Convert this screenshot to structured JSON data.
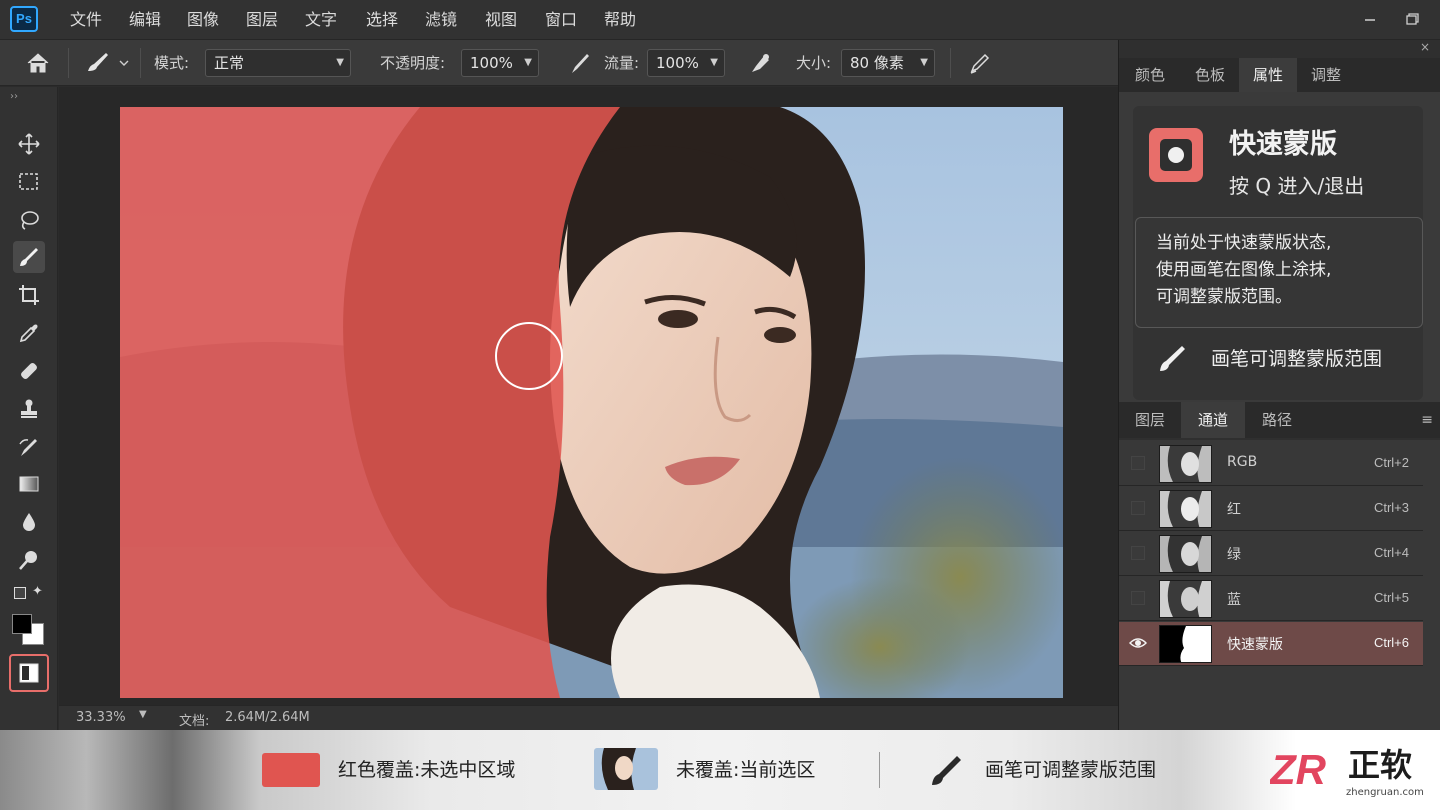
{
  "menubar": {
    "logo": "Ps",
    "items": [
      "文件",
      "编辑",
      "图像",
      "图层",
      "文字",
      "选择",
      "滤镜",
      "视图",
      "窗口",
      "帮助"
    ]
  },
  "options": {
    "mode_label": "模式:",
    "mode_value": "正常",
    "opacity_label": "不透明度:",
    "opacity_value": "100%",
    "flow_label": "流量:",
    "flow_value": "100%",
    "size_label": "大小:",
    "size_value": "80 像素"
  },
  "status": {
    "zoom": "33.33%",
    "doc_label": "文档:",
    "doc_value": "2.64M/2.64M"
  },
  "panel_top": {
    "tabs": [
      "颜色",
      "色板",
      "属性",
      "调整"
    ],
    "active_tab": "属性",
    "quickmask_title": "快速蒙版",
    "quickmask_subtitle": "按 Q 进入/退出",
    "desc_lines": [
      "当前处于快速蒙版状态,",
      "使用画笔在图像上涂抹,",
      "可调整蒙版范围。"
    ],
    "brush_hint": "画笔可调整蒙版范围"
  },
  "panel_bottom": {
    "tabs": [
      "图层",
      "通道",
      "路径"
    ],
    "active_tab": "通道",
    "channels": [
      {
        "name": "RGB",
        "shortcut": "Ctrl+2"
      },
      {
        "name": "红",
        "shortcut": "Ctrl+3"
      },
      {
        "name": "绿",
        "shortcut": "Ctrl+4"
      },
      {
        "name": "蓝",
        "shortcut": "Ctrl+5"
      },
      {
        "name": "快速蒙版",
        "shortcut": "Ctrl+6",
        "selected": true
      }
    ]
  },
  "caption": {
    "red_label": "红色覆盖:未选中区域",
    "clear_label": "未覆盖:当前选区",
    "brush_label": "画笔可调整蒙版范围",
    "brand_name": "正软",
    "brand_url": "zhengruan.com"
  },
  "colors": {
    "mask_red": "#e05550",
    "accent_highlight": "#e86e6a",
    "ps_blue": "#31a8ff"
  }
}
